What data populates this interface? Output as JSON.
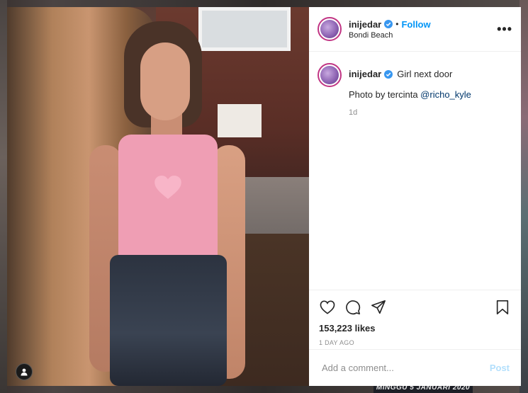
{
  "post": {
    "username": "inijedar",
    "follow_label": "Follow",
    "separator": "•",
    "location": "Bondi Beach",
    "more_icon": "more-options-icon",
    "caption": {
      "username": "inijedar",
      "text": "Girl next door",
      "credit_prefix": "Photo by tercinta ",
      "mention": "@richo_kyle",
      "age": "1d"
    },
    "likes": "153,223 likes",
    "time_ago": "1 DAY AGO",
    "comment": {
      "placeholder": "Add a comment...",
      "post_label": "Post"
    }
  },
  "background": {
    "banner_text": "MINGGU 5 JANUARI 2020"
  },
  "colors": {
    "accent": "#0095f6",
    "verified": "#3897f0",
    "post_disabled": "#b2dffc",
    "shirt": "#ef9eb4",
    "heart": "#f8b5c8"
  },
  "icons": [
    "verified-badge-icon",
    "heart-icon",
    "comment-icon",
    "share-icon",
    "bookmark-icon",
    "user-tag-icon",
    "heart-sticker-icon"
  ]
}
